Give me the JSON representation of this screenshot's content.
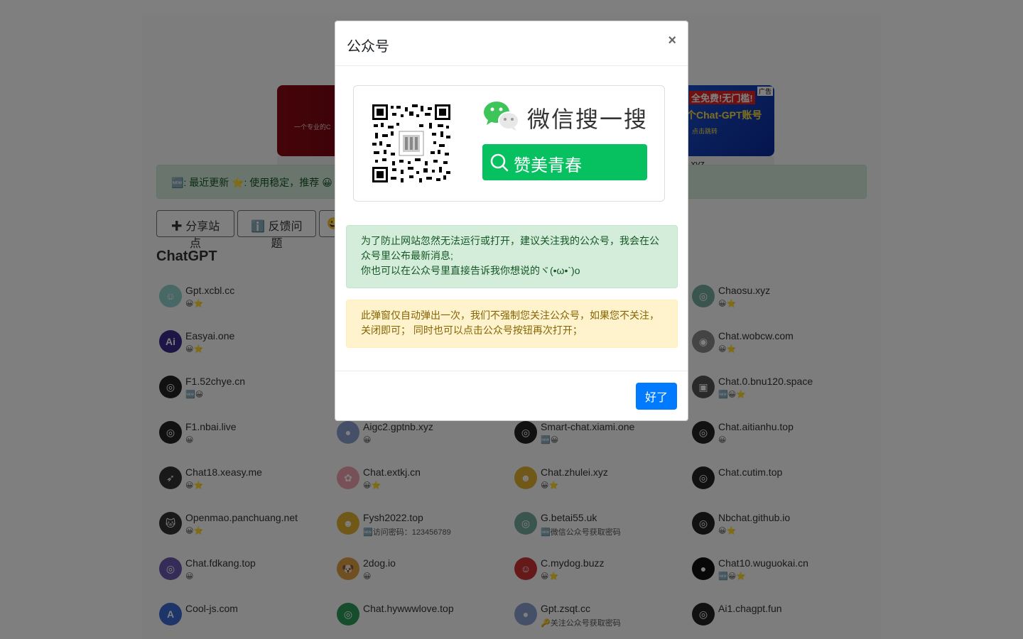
{
  "banners": {
    "left_text": "一个专业的C",
    "right_line1": "全免费!无门槛!",
    "right_line2": "个Chat-GPT账号",
    "right_line3": "点击跳转",
    "right_ad": "广告",
    "right_caption": "i.xyz"
  },
  "legend": {
    "text": "🆕: 最近更新 ⭐: 使用稳定，推荐 😀"
  },
  "toolbar": {
    "share_label": "✚ 分享站点",
    "feedback_label": "ℹ️ 反馈问题",
    "third_label": "😀"
  },
  "section": {
    "title": "ChatGPT"
  },
  "sites": [
    {
      "name": "Gpt.xcbl.cc",
      "tags": "😀⭐",
      "color": "#8fd0c8",
      "glyph": "☺"
    },
    {
      "name": "Chaosu.xyz",
      "tags": "😀⭐",
      "color": "#74aa9c",
      "glyph": "◎"
    },
    {
      "name": "Easyai.one",
      "tags": "😀⭐",
      "color": "#3a2a8a",
      "glyph": "Ai"
    },
    {
      "name": "Chat.wobcw.com",
      "tags": "😀⭐",
      "color": "#888888",
      "glyph": "◉"
    },
    {
      "name": "F1.52chye.cn",
      "tags": "🆕😀",
      "color": "#222222",
      "glyph": "◎"
    },
    {
      "name": "Chat.0.bnu120.space",
      "tags": "🆕😀⭐",
      "color": "#555555",
      "glyph": "▣"
    },
    {
      "name": "F1.nbai.live",
      "tags": "😀",
      "color": "#222222",
      "glyph": "◎"
    },
    {
      "name": "Aigc2.gptnb.xyz",
      "tags": "😀",
      "color": "#8aa0d0",
      "glyph": "●"
    },
    {
      "name": "Smart-chat.xiami.one",
      "tags": "🆕😀",
      "color": "#222222",
      "glyph": "◎"
    },
    {
      "name": "Chat.aitianhu.top",
      "tags": "😀",
      "color": "#222222",
      "glyph": "◎"
    },
    {
      "name": "Chat18.xeasy.me",
      "tags": "😀⭐",
      "color": "#333333",
      "glyph": "➶"
    },
    {
      "name": "Chat.extkj.cn",
      "tags": "😀⭐",
      "color": "#f0a0b0",
      "glyph": "✿"
    },
    {
      "name": "Chat.zhulei.xyz",
      "tags": "😀⭐",
      "color": "#e0b030",
      "glyph": "☻"
    },
    {
      "name": "Chat.cutim.top",
      "tags": "",
      "color": "#222222",
      "glyph": "◎"
    },
    {
      "name": "Openmao.panchuang.net",
      "tags": "😀⭐",
      "color": "#333333",
      "glyph": "🐱"
    },
    {
      "name": "Fysh2022.top",
      "tags": "🆕访问密码：123456789",
      "color": "#e0b030",
      "glyph": "☻"
    },
    {
      "name": "G.betai55.uk",
      "tags": "🆕微信公众号获取密码",
      "color": "#74aa9c",
      "glyph": "◎"
    },
    {
      "name": "Nbchat.github.io",
      "tags": "😀⭐",
      "color": "#222222",
      "glyph": "◎"
    },
    {
      "name": "Chat.fdkang.top",
      "tags": "😀",
      "color": "#6a5ab0",
      "glyph": "◎"
    },
    {
      "name": "2dog.io",
      "tags": "😀",
      "color": "#e0a040",
      "glyph": "🐶"
    },
    {
      "name": "C.mydog.buzz",
      "tags": "😀⭐",
      "color": "#cc3333",
      "glyph": "☺"
    },
    {
      "name": "Chat10.wuguokai.cn",
      "tags": "🆕😀⭐",
      "color": "#111111",
      "glyph": "●"
    },
    {
      "name": "Cool-js.com",
      "tags": "",
      "color": "#3a6ad0",
      "glyph": "A"
    },
    {
      "name": "Chat.hywwwlove.top",
      "tags": "",
      "color": "#2a9a5a",
      "glyph": "◎"
    },
    {
      "name": "Gpt.zsqt.cc",
      "tags": "🔑关注公众号获取密码",
      "color": "#8aa0d0",
      "glyph": "●"
    },
    {
      "name": "Ai1.chagpt.fun",
      "tags": "",
      "color": "#222222",
      "glyph": "◎"
    }
  ],
  "modal": {
    "title": "公众号",
    "close_label": "×",
    "wechat_search_text": "微信搜一搜",
    "search_keyword": "赞美青春",
    "success_text": "为了防止网站忽然无法运行或打开，建议关注我的公众号，我会在公众号里公布最新消息;\n你也可以在公众号里直接告诉我你想说的ヾ(•ω•`)o",
    "warning_text": "此弹窗仅自动弹出一次，我们不强制您关注公众号，如果您不关注，关闭即可；  同时也可以点击公众号按钮再次打开；",
    "ok_label": "好了"
  }
}
